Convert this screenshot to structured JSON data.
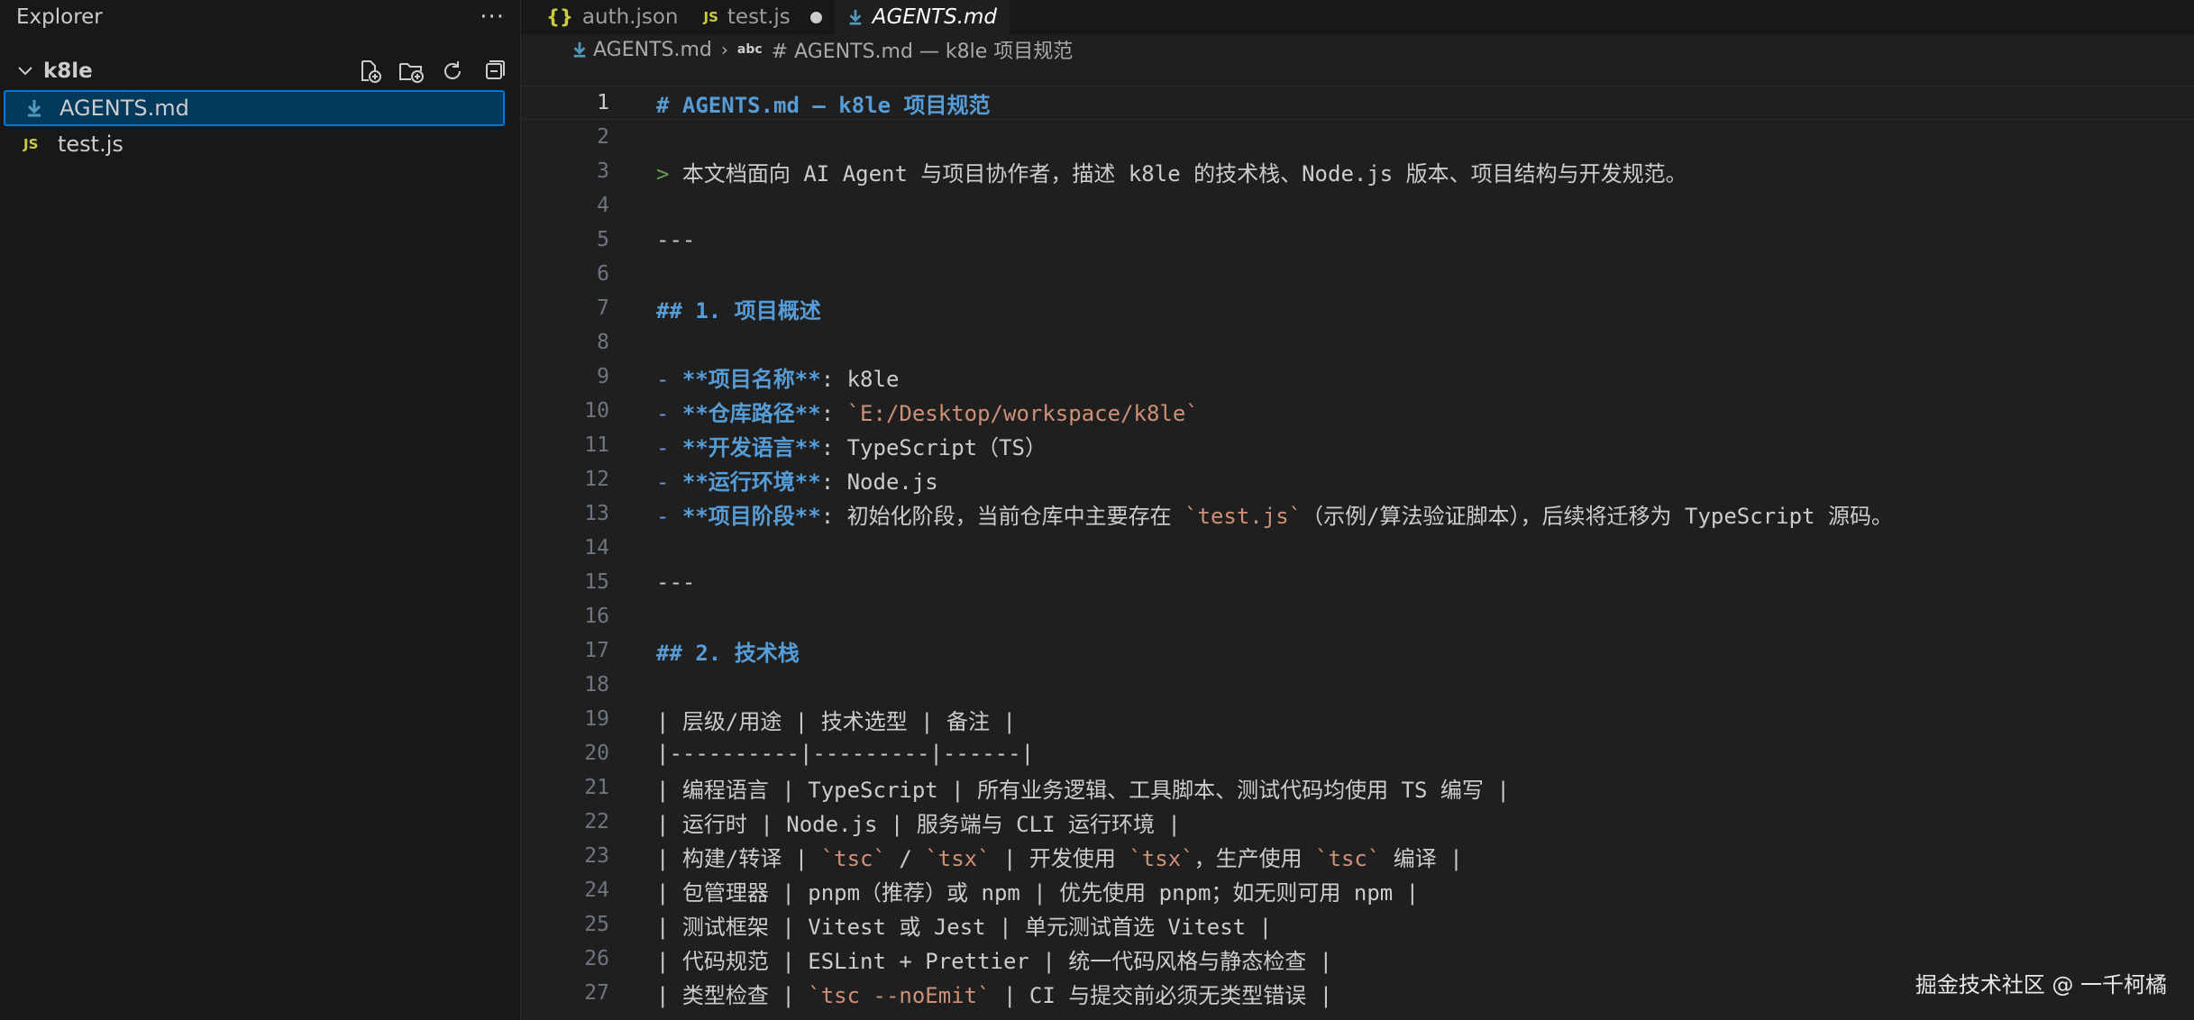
{
  "sidebar": {
    "title": "Explorer",
    "more": "···",
    "folder": "k8le",
    "files": [
      {
        "name": "AGENTS.md",
        "type": "md",
        "selected": true
      },
      {
        "name": "test.js",
        "type": "js",
        "badge": "JS",
        "selected": false
      }
    ]
  },
  "tabs": [
    {
      "label": "auth.json",
      "badge": "{}"
    },
    {
      "label": "test.js",
      "badge": "JS",
      "dirty": true
    },
    {
      "label": "AGENTS.md",
      "active": true
    }
  ],
  "breadcrumb": {
    "file": "AGENTS.md",
    "symbol": "# AGENTS.md — k8le 项目规范",
    "symbol_icon": "abc"
  },
  "lines": [
    {
      "n": "1",
      "segs": [
        {
          "t": "# AGENTS.md — k8le 项目规范",
          "c": "h"
        }
      ]
    },
    {
      "n": "2",
      "segs": []
    },
    {
      "n": "3",
      "segs": [
        {
          "t": "> ",
          "c": "quote"
        },
        {
          "t": "本文档面向 AI Agent 与项目协作者，描述 k8le 的技术栈、Node.js 版本、项目结构与开发规范。",
          "c": ""
        }
      ]
    },
    {
      "n": "4",
      "segs": []
    },
    {
      "n": "5",
      "segs": [
        {
          "t": "---",
          "c": ""
        }
      ]
    },
    {
      "n": "6",
      "segs": []
    },
    {
      "n": "7",
      "segs": [
        {
          "t": "## 1. 项目概述",
          "c": "h"
        }
      ]
    },
    {
      "n": "8",
      "segs": []
    },
    {
      "n": "9",
      "segs": [
        {
          "t": "- ",
          "c": "punc"
        },
        {
          "t": "**项目名称**",
          "c": "bold"
        },
        {
          "t": ": k8le",
          "c": ""
        }
      ]
    },
    {
      "n": "10",
      "segs": [
        {
          "t": "- ",
          "c": "punc"
        },
        {
          "t": "**仓库路径**",
          "c": "bold"
        },
        {
          "t": ": ",
          "c": ""
        },
        {
          "t": "`E:/Desktop/workspace/k8le`",
          "c": "inline"
        }
      ]
    },
    {
      "n": "11",
      "segs": [
        {
          "t": "- ",
          "c": "punc"
        },
        {
          "t": "**开发语言**",
          "c": "bold"
        },
        {
          "t": ": TypeScript（TS）",
          "c": ""
        }
      ]
    },
    {
      "n": "12",
      "segs": [
        {
          "t": "- ",
          "c": "punc"
        },
        {
          "t": "**运行环境**",
          "c": "bold"
        },
        {
          "t": ": Node.js",
          "c": ""
        }
      ]
    },
    {
      "n": "13",
      "segs": [
        {
          "t": "- ",
          "c": "punc"
        },
        {
          "t": "**项目阶段**",
          "c": "bold"
        },
        {
          "t": ": 初始化阶段，当前仓库中主要存在 ",
          "c": ""
        },
        {
          "t": "`test.js`",
          "c": "inline"
        },
        {
          "t": "（示例/算法验证脚本），后续将迁移为 TypeScript 源码。",
          "c": ""
        }
      ]
    },
    {
      "n": "14",
      "segs": []
    },
    {
      "n": "15",
      "segs": [
        {
          "t": "---",
          "c": ""
        }
      ]
    },
    {
      "n": "16",
      "segs": []
    },
    {
      "n": "17",
      "segs": [
        {
          "t": "## 2. 技术栈",
          "c": "h"
        }
      ]
    },
    {
      "n": "18",
      "segs": []
    },
    {
      "n": "19",
      "segs": [
        {
          "t": "| 层级/用途 | 技术选型 | 备注 |",
          "c": ""
        }
      ]
    },
    {
      "n": "20",
      "segs": [
        {
          "t": "|----------|---------|------|",
          "c": ""
        }
      ]
    },
    {
      "n": "21",
      "segs": [
        {
          "t": "| 编程语言 | TypeScript | 所有业务逻辑、工具脚本、测试代码均使用 TS 编写 |",
          "c": ""
        }
      ]
    },
    {
      "n": "22",
      "segs": [
        {
          "t": "| 运行时 | Node.js | 服务端与 CLI 运行环境 |",
          "c": ""
        }
      ]
    },
    {
      "n": "23",
      "segs": [
        {
          "t": "| 构建/转译 | ",
          "c": ""
        },
        {
          "t": "`tsc`",
          "c": "inline"
        },
        {
          "t": " / ",
          "c": ""
        },
        {
          "t": "`tsx`",
          "c": "inline"
        },
        {
          "t": " | 开发使用 ",
          "c": ""
        },
        {
          "t": "`tsx`",
          "c": "inline"
        },
        {
          "t": "，生产使用 ",
          "c": ""
        },
        {
          "t": "`tsc`",
          "c": "inline"
        },
        {
          "t": " 编译 |",
          "c": ""
        }
      ]
    },
    {
      "n": "24",
      "segs": [
        {
          "t": "| 包管理器 | pnpm（推荐）或 npm | 优先使用 pnpm；如无则可用 npm |",
          "c": ""
        }
      ]
    },
    {
      "n": "25",
      "segs": [
        {
          "t": "| 测试框架 | Vitest 或 Jest | 单元测试首选 Vitest |",
          "c": ""
        }
      ]
    },
    {
      "n": "26",
      "segs": [
        {
          "t": "| 代码规范 | ESLint + Prettier | 统一代码风格与静态检查 |",
          "c": ""
        }
      ]
    },
    {
      "n": "27",
      "segs": [
        {
          "t": "| 类型检查 | ",
          "c": ""
        },
        {
          "t": "`tsc --noEmit`",
          "c": "inline"
        },
        {
          "t": " | CI 与提交前必须无类型错误 |",
          "c": ""
        }
      ]
    }
  ],
  "watermark": "掘金技术社区 @ 一千柯橘",
  "colors": {
    "heading": "#569cd6",
    "inline_code": "#ce9178",
    "quote": "#6a9955",
    "selection": "#04395e",
    "focus_border": "#0078d4"
  }
}
